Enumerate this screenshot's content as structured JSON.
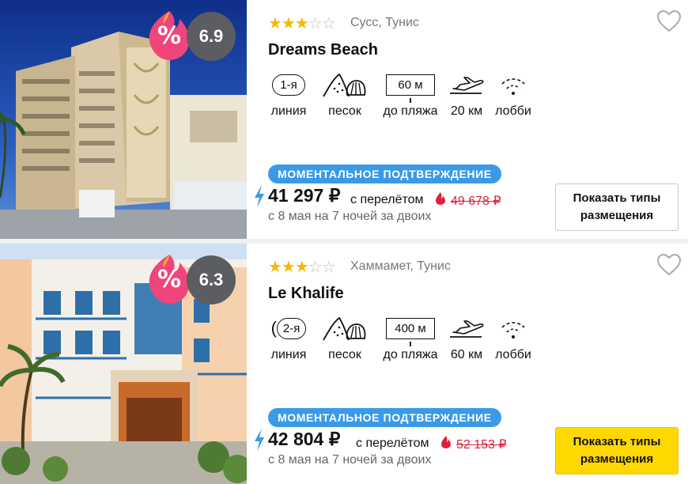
{
  "hotels": [
    {
      "stars": 3,
      "stars_max": 5,
      "location": "Сусс, Тунис",
      "name": "Dreams Beach",
      "discount_icon": "%",
      "rating": "6.9",
      "line_value": "1-я",
      "line_label": "линия",
      "beach_label": "песок",
      "distance_value": "60 м",
      "distance_label": "до пляжа",
      "airport_label": "20 км",
      "wifi_label": "лобби",
      "badge": "МОМЕНТАЛЬНОЕ ПОДТВЕРЖДЕНИЕ",
      "price": "41 297 ₽",
      "price_note": "с перелётом",
      "old_price": "49 678 ₽",
      "dates": "с 8 мая на 7 ночей за двоих",
      "button_line1": "Показать типы",
      "button_line2": "размещения",
      "button_style": "white"
    },
    {
      "stars": 3,
      "stars_max": 5,
      "location": "Хаммамет, Тунис",
      "name": "Le Khalife",
      "discount_icon": "%",
      "rating": "6.3",
      "line_value": "2-я",
      "line_label": "линия",
      "beach_label": "песок",
      "distance_value": "400 м",
      "distance_label": "до пляжа",
      "airport_label": "60 км",
      "wifi_label": "лобби",
      "badge": "МОМЕНТАЛЬНОЕ ПОДТВЕРЖДЕНИЕ",
      "price": "42 804 ₽",
      "price_note": "с перелётом",
      "old_price": "52 153 ₽",
      "dates": "с 8 мая на 7 ночей за двоих",
      "button_line1": "Показать типы",
      "button_line2": "размещения",
      "button_style": "yellow"
    }
  ],
  "colors": {
    "star": "#f5b800",
    "badge": "#3a9ae8",
    "old_price": "#e0203b",
    "rating_bg": "#5b5d60",
    "discount": "#f0457a",
    "button_primary": "#ffd800"
  },
  "icons": [
    "heart-icon",
    "fire-icon",
    "lightning-icon",
    "sand-shell-icon",
    "airplane-icon",
    "wifi-icon"
  ]
}
